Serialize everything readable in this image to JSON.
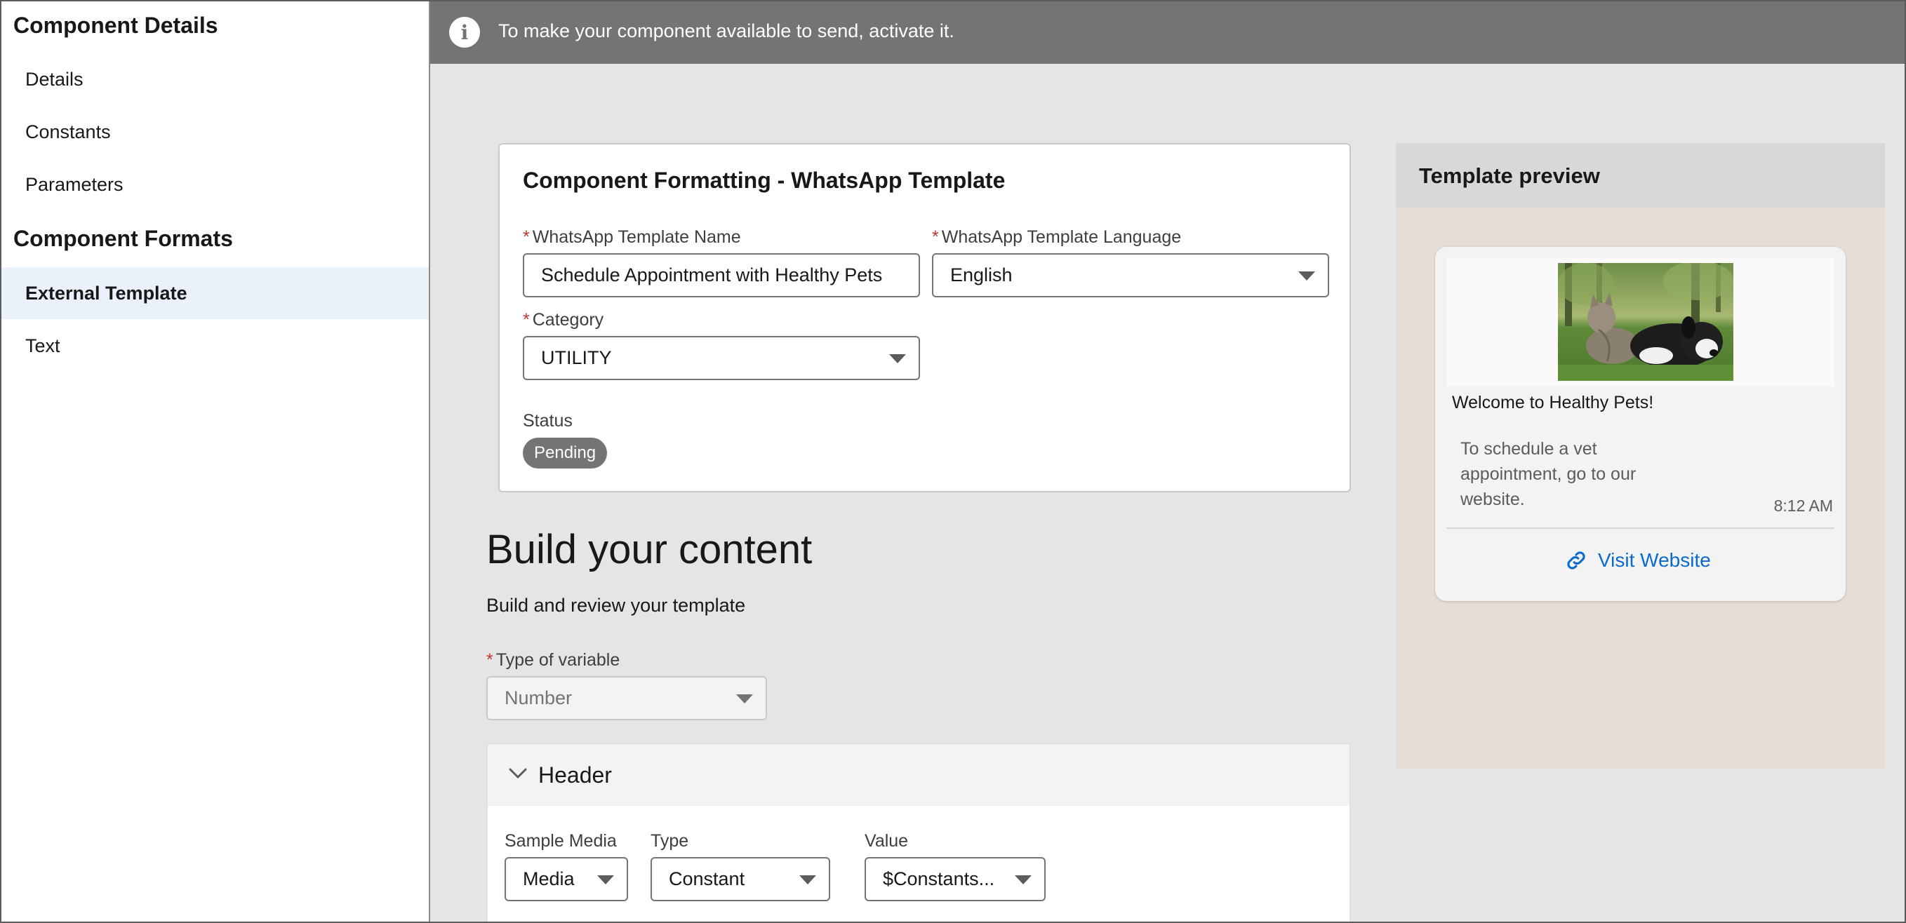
{
  "sidebar": {
    "section1_title": "Component Details",
    "section1_items": [
      {
        "label": "Details"
      },
      {
        "label": "Constants"
      },
      {
        "label": "Parameters"
      }
    ],
    "section2_title": "Component Formats",
    "section2_items": [
      {
        "label": "External Template",
        "active": true
      },
      {
        "label": "Text",
        "active": false
      }
    ]
  },
  "banner": {
    "icon": "info-icon",
    "text": "To make your component available to send, activate it."
  },
  "card": {
    "title": "Component Formatting - WhatsApp Template",
    "template_name": {
      "label": "WhatsApp Template Name",
      "value": "Schedule Appointment with Healthy Pets",
      "required_mark": "*"
    },
    "template_language": {
      "label": "WhatsApp Template Language",
      "value": "English",
      "required_mark": "*"
    },
    "category": {
      "label": "Category",
      "value": "UTILITY",
      "required_mark": "*"
    },
    "status": {
      "label": "Status",
      "value": "Pending"
    }
  },
  "build": {
    "title": "Build your content",
    "subtitle": "Build and review your template",
    "variable_type": {
      "label": "Type of variable",
      "value": "Number",
      "required_mark": "*"
    }
  },
  "accordion": {
    "title": "Header",
    "sample_media": {
      "label": "Sample Media",
      "value": "Media"
    },
    "type": {
      "label": "Type",
      "value": "Constant"
    },
    "value": {
      "label": "Value",
      "value": "$Constants..."
    }
  },
  "preview": {
    "title": "Template preview",
    "welcome": "Welcome to Healthy Pets!",
    "body": "To schedule a vet appointment, go to our website.",
    "time": "8:12 AM",
    "link_label": "Visit Website",
    "link_icon": "link-icon",
    "accent": "#0b6bcb"
  }
}
